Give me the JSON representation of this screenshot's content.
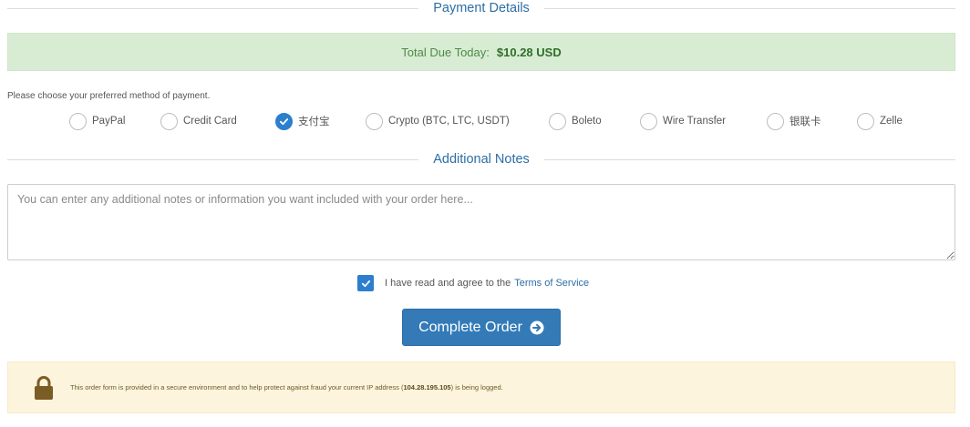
{
  "payment_section": {
    "title": "Payment Details",
    "total_label": "Total Due Today:",
    "total_amount": "$10.28 USD",
    "choose_prompt": "Please choose your preferred method of payment.",
    "methods": [
      {
        "label": "PayPal",
        "checked": false
      },
      {
        "label": "Credit Card",
        "checked": false
      },
      {
        "label": "支付宝",
        "checked": true
      },
      {
        "label": "Crypto (BTC, LTC, USDT)",
        "checked": false
      },
      {
        "label": "Boleto",
        "checked": false
      },
      {
        "label": "Wire Transfer",
        "checked": false
      },
      {
        "label": "银联卡",
        "checked": false
      },
      {
        "label": "Zelle",
        "checked": false
      }
    ]
  },
  "notes_section": {
    "title": "Additional Notes",
    "placeholder": "You can enter any additional notes or information you want included with your order here..."
  },
  "terms": {
    "checked": true,
    "text": "I have read and agree to the",
    "link": "Terms of Service"
  },
  "complete_button": {
    "label": "Complete Order",
    "icon": "arrow-circle-right-icon"
  },
  "security_alert": {
    "icon": "lock-icon",
    "text_before": "This order form is provided in a secure environment and to help protect against fraud your current IP address (",
    "ip": "104.28.195.105",
    "text_after": ") is being logged."
  },
  "colors": {
    "accent": "#337ab7",
    "section_title": "#2d6ea5",
    "success_bg": "#d8ecd4",
    "warning_bg": "#fcf4dc",
    "lock": "#7a5c25"
  }
}
